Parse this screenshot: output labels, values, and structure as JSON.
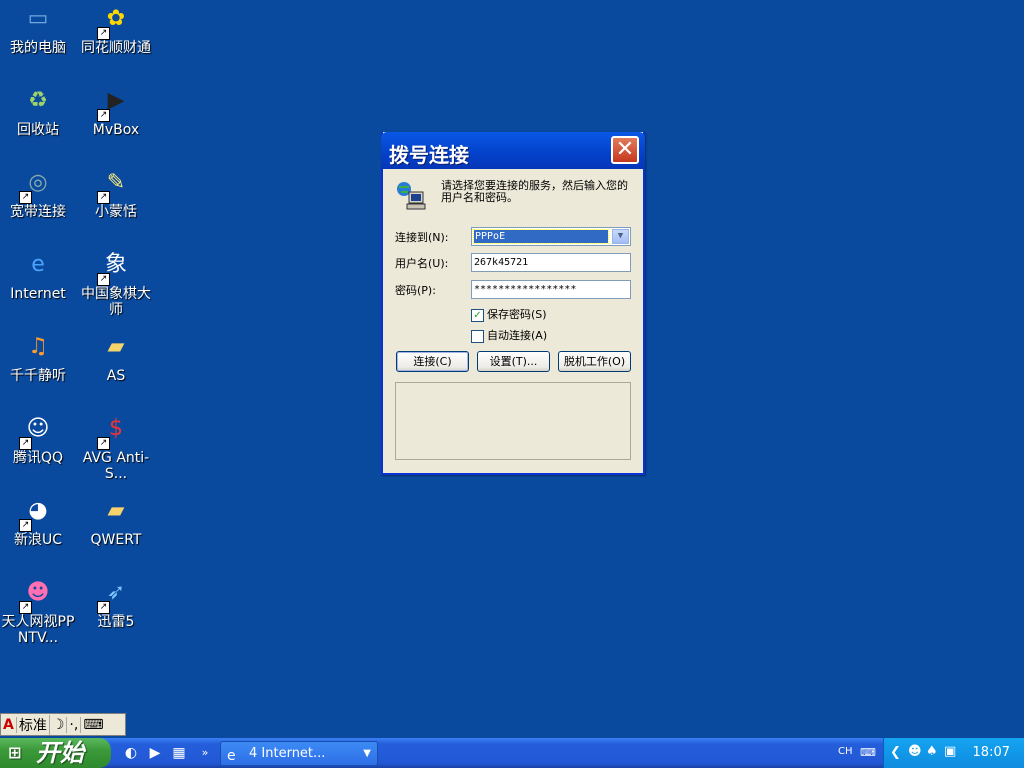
{
  "desktop": {
    "icons": [
      {
        "label": "我的电脑",
        "icon": "my-computer-icon"
      },
      {
        "label": "同花顺财通",
        "icon": "tonghuashun-icon"
      },
      {
        "label": "回收站",
        "icon": "recycle-bin-icon"
      },
      {
        "label": "MvBox",
        "icon": "mvbox-icon"
      },
      {
        "label": "宽带连接",
        "icon": "broadband-icon"
      },
      {
        "label": "小蒙恬",
        "icon": "xiaomengtian-icon"
      },
      {
        "label": "Internet",
        "icon": "internet-explorer-icon"
      },
      {
        "label": "中国象棋大师",
        "icon": "chinese-chess-icon"
      },
      {
        "label": "千千静听",
        "icon": "ttplayer-icon"
      },
      {
        "label": "AS",
        "icon": "folder-icon"
      },
      {
        "label": "腾讯QQ",
        "icon": "qq-icon"
      },
      {
        "label": "AVG Anti-S...",
        "icon": "avg-icon"
      },
      {
        "label": "新浪UC",
        "icon": "sina-uc-icon"
      },
      {
        "label": "QWERT",
        "icon": "folder-icon"
      },
      {
        "label": "天人网视PPNTV...",
        "icon": "ppntv-icon"
      },
      {
        "label": "迅雷5",
        "icon": "thunder-icon"
      }
    ]
  },
  "dialog": {
    "title": "拨号连接",
    "intro": "请选择您要连接的服务，然后输入您的用户名和密码。",
    "connect_to_label": "连接到(N):",
    "connect_to_value": "PPPoE",
    "username_label": "用户名(U):",
    "username_value": "267k45721",
    "password_label": "密码(P):",
    "password_value": "*****************",
    "save_password_label": "保存密码(S)",
    "save_password_checked": true,
    "auto_connect_label": "自动连接(A)",
    "auto_connect_checked": false,
    "connect_button": "连接(C)",
    "settings_button": "设置(T)...",
    "offline_button": "脱机工作(O)",
    "close_glyph": "✕"
  },
  "langbar": {
    "ime": "标准",
    "moon": "☽",
    "punct": "·,"
  },
  "taskbar": {
    "start_label": "开始",
    "task_label": "4 Internet...",
    "lang": "CH",
    "clock": "18:07"
  }
}
